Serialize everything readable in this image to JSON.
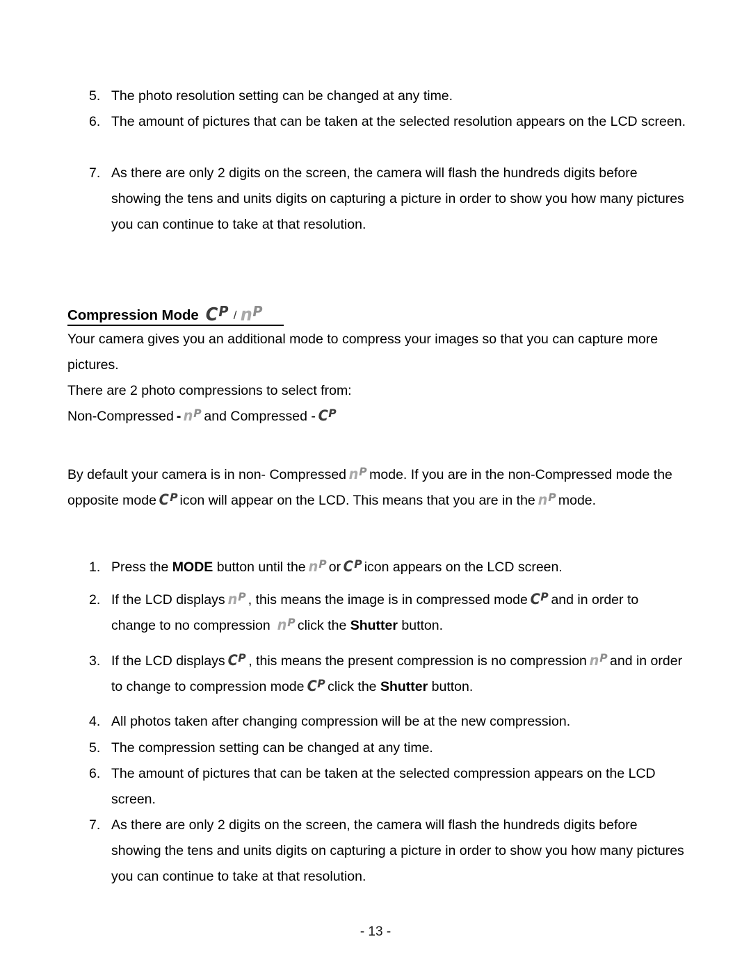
{
  "document": {
    "page_number_label": "- 13 -"
  },
  "icons": {
    "cp": {
      "name": "lcd-cp-icon",
      "char1": "C",
      "char2": "P",
      "meaning": "Compressed",
      "color": "#3c3c3c"
    },
    "np": {
      "name": "lcd-np-icon",
      "char1": "n",
      "char2": "P",
      "meaning": "Non-Compressed",
      "color": "#a8a8a8"
    }
  },
  "top_list": {
    "items": [
      {
        "num": "5.",
        "text": "The photo resolution setting can be changed at any time."
      },
      {
        "num": "6.",
        "text": "The amount of pictures that can be taken at the selected resolution appears on the LCD screen."
      },
      {
        "num": "7.",
        "text": "As there are only 2 digits on the screen, the camera will flash the hundreds digits before showing the tens and units digits on capturing a picture in order to show you how many pictures you can continue to take at that resolution."
      }
    ]
  },
  "heading": {
    "title": "Compression Mode",
    "separator": "/"
  },
  "intro": {
    "para1": "Your camera gives you an additional mode to compress your images so that you can capture more   pictures.",
    "para2": "There are 2 photo compressions to select from:",
    "para3_prefix": "Non-Compressed",
    "para3_dash": "-",
    "para3_middle": "and Compressed -",
    "para4_a": "By default your camera is in non- Compressed",
    "para4_b": "mode. If you are in the non-Compressed mode the opposite mode",
    "para4_c": "icon will appear on the LCD. This means that you are in the",
    "para4_d": "mode."
  },
  "steps": {
    "items": [
      {
        "num": "1.",
        "a": "Press the",
        "bold1": "MODE",
        "b": "button until the",
        "c": "or",
        "d": "icon appears on the LCD screen."
      },
      {
        "num": "2.",
        "a": "If the LCD displays",
        "b": ", this means the image is in compressed mode",
        "c": "and in order to change to no compression",
        "d": "click the",
        "bold1": "Shutter",
        "e": "button."
      },
      {
        "num": "3.",
        "a": "If the LCD displays",
        "b": ", this means the present compression is no compression",
        "c": "and in order to change to compression mode",
        "d": "click the",
        "bold1": "Shutter",
        "e": "button."
      },
      {
        "num": "4.",
        "text": "All photos taken after changing compression will be at the new compression."
      },
      {
        "num": "5.",
        "text": "The compression setting can be changed at any time."
      },
      {
        "num": "6.",
        "text": "The amount of pictures that can be taken at the selected compression appears on the LCD screen."
      },
      {
        "num": "7.",
        "text": "As there are only 2 digits on the screen, the camera will flash the hundreds digits before showing the tens and units digits on capturing a picture in order to show you how many pictures you can continue to take at that resolution."
      }
    ]
  }
}
